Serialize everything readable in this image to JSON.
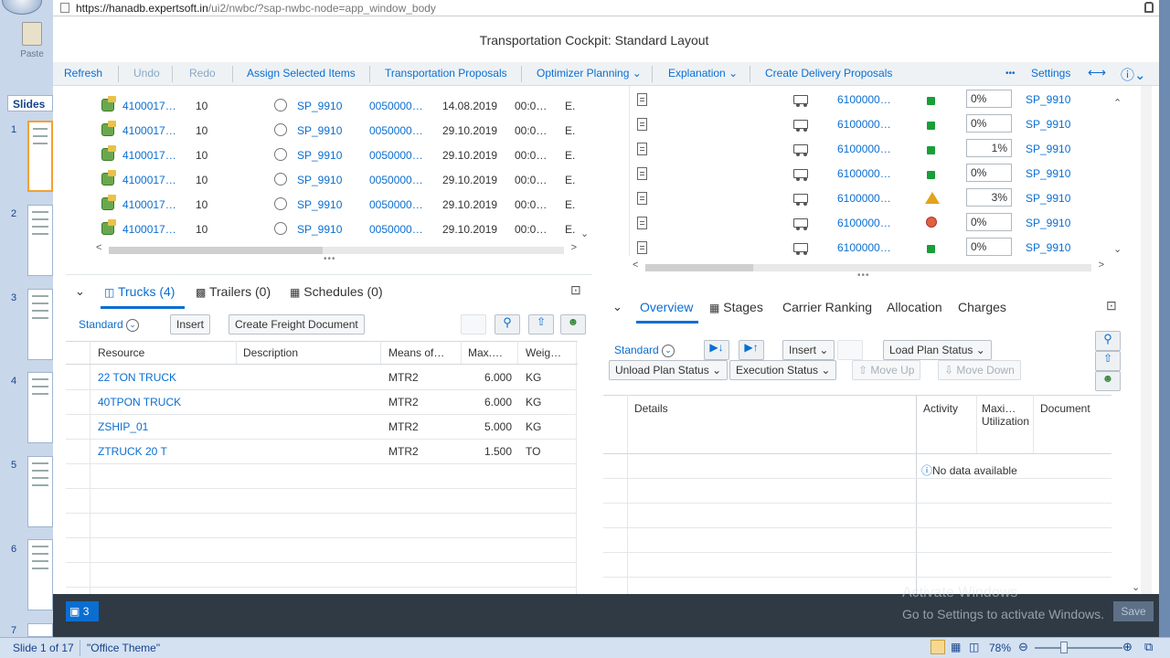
{
  "browser": {
    "url_host": "https://hanadb.expertsoft.in",
    "url_path": "/ui2/nwbc/?sap-nwbc-node=app_window_body"
  },
  "powerpoint": {
    "paste_label": "Paste",
    "slides_tab": "Slides",
    "thumb_numbers": [
      "1",
      "2",
      "3",
      "4",
      "5",
      "6",
      "7"
    ],
    "status_slide": "Slide 1 of 17",
    "status_theme": "\"Office Theme\"",
    "zoom": "78%",
    "windows_watermark_line1": "Activate Windows",
    "windows_watermark_line2": "Go to Settings to activate Windows."
  },
  "app": {
    "title": "Transportation Cockpit: Standard Layout",
    "toolbar": {
      "refresh": "Refresh",
      "undo": "Undo",
      "redo": "Redo",
      "assign": "Assign Selected Items",
      "proposals": "Transportation Proposals",
      "optimizer": "Optimizer Planning",
      "explanation": "Explanation",
      "delivery": "Create Delivery Proposals",
      "more": "•••",
      "settings": "Settings"
    },
    "top_left_rows": [
      {
        "id": "4100017…",
        "qty": "10",
        "loc": "SP_9910",
        "ref": "0050000…",
        "date": "14.08.2019",
        "time": "00:0…",
        "e": "E."
      },
      {
        "id": "4100017…",
        "qty": "10",
        "loc": "SP_9910",
        "ref": "0050000…",
        "date": "29.10.2019",
        "time": "00:0…",
        "e": "E."
      },
      {
        "id": "4100017…",
        "qty": "10",
        "loc": "SP_9910",
        "ref": "0050000…",
        "date": "29.10.2019",
        "time": "00:0…",
        "e": "E."
      },
      {
        "id": "4100017…",
        "qty": "10",
        "loc": "SP_9910",
        "ref": "0050000…",
        "date": "29.10.2019",
        "time": "00:0…",
        "e": "E."
      },
      {
        "id": "4100017…",
        "qty": "10",
        "loc": "SP_9910",
        "ref": "0050000…",
        "date": "29.10.2019",
        "time": "00:0…",
        "e": "E."
      },
      {
        "id": "4100017…",
        "qty": "10",
        "loc": "SP_9910",
        "ref": "0050000…",
        "date": "29.10.2019",
        "time": "00:0…",
        "e": "E."
      }
    ],
    "top_right_rows": [
      {
        "doc": "6100000…",
        "status": "green",
        "pct": "0%",
        "loc": "SP_9910"
      },
      {
        "doc": "6100000…",
        "status": "green",
        "pct": "0%",
        "loc": "SP_9910"
      },
      {
        "doc": "6100000…",
        "status": "green",
        "pct": "1%",
        "loc": "SP_9910"
      },
      {
        "doc": "6100000…",
        "status": "green",
        "pct": "0%",
        "loc": "SP_9910"
      },
      {
        "doc": "6100000…",
        "status": "warning",
        "pct": "3%",
        "loc": "SP_9910"
      },
      {
        "doc": "6100000…",
        "status": "red",
        "pct": "0%",
        "loc": "SP_9910"
      },
      {
        "doc": "6100000…",
        "status": "green",
        "pct": "0%",
        "loc": "SP_9910"
      }
    ],
    "resources": {
      "tabs": [
        "Trucks (4)",
        "Trailers (0)",
        "Schedules (0)"
      ],
      "variant": "Standard",
      "insert": "Insert",
      "create_freight": "Create Freight Document",
      "headers": [
        "Resource",
        "Description",
        "Means of…",
        "Max.…",
        "Weig…"
      ],
      "rows": [
        {
          "resource": "22 TON TRUCK",
          "means": "MTR2",
          "max": "6.000",
          "unit": "KG"
        },
        {
          "resource": "40TPON TRUCK",
          "means": "MTR2",
          "max": "6.000",
          "unit": "KG"
        },
        {
          "resource": "ZSHIP_01",
          "means": "MTR2",
          "max": "5.000",
          "unit": "KG"
        },
        {
          "resource": "ZTRUCK 20 T",
          "means": "MTR2",
          "max": "1.500",
          "unit": "TO"
        }
      ]
    },
    "overview": {
      "tabs": [
        "Overview",
        "Stages",
        "Carrier Ranking",
        "Allocation",
        "Charges"
      ],
      "variant": "Standard",
      "insert": "Insert",
      "load_plan": "Load Plan Status",
      "unload_plan": "Unload Plan Status",
      "exec_status": "Execution Status",
      "move_up": "Move Up",
      "move_down": "Move Down",
      "headers": [
        "Details",
        "Activity",
        "Maxi… Utilization",
        "Document"
      ],
      "no_data": "No data available"
    },
    "footer": {
      "messages": "3",
      "save": "Save"
    }
  }
}
